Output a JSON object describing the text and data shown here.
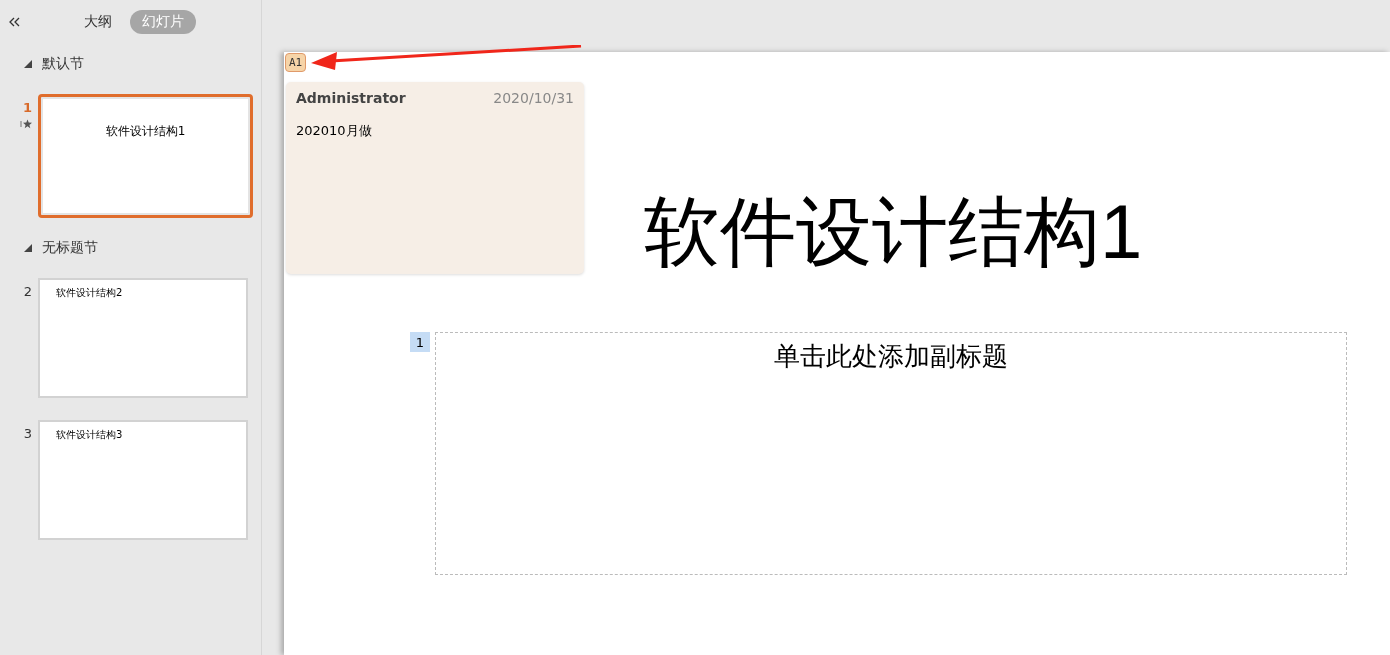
{
  "panel_tabs": [
    {
      "label": "大纲",
      "selected": false
    },
    {
      "label": "幻灯片",
      "selected": true
    }
  ],
  "sections": [
    {
      "title": "默认节",
      "expanded": true,
      "slides": [
        {
          "number": "1",
          "title": "软件设计结构1",
          "selected": true,
          "animated": true,
          "kind": "title"
        }
      ]
    },
    {
      "title": "无标题节",
      "expanded": true,
      "slides": [
        {
          "number": "2",
          "title": "软件设计结构2",
          "selected": false,
          "animated": false,
          "kind": "content"
        },
        {
          "number": "3",
          "title": "软件设计结构3",
          "selected": false,
          "animated": false,
          "kind": "content"
        }
      ]
    }
  ],
  "slide": {
    "comment_marker": "A1",
    "comment": {
      "author": "Administrator",
      "date": "2020/10/31",
      "text": "202010月做"
    },
    "title": "软件设计结构1",
    "placeholder_number": "1",
    "subtitle_placeholder": "单击此处添加副标题"
  }
}
